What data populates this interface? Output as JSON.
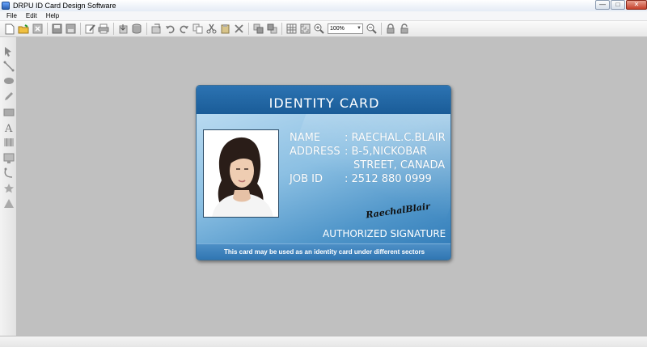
{
  "window": {
    "title": "DRPU ID Card Design Software",
    "minimize": "—",
    "maximize": "□",
    "close": "✕"
  },
  "menu": [
    {
      "label": "File"
    },
    {
      "label": "Edit"
    },
    {
      "label": "Help"
    }
  ],
  "toolbar": {
    "zoom": "100%",
    "zoom_arrow": "▼"
  },
  "card": {
    "title": "IDENTITY CARD",
    "name_label": "NAME",
    "name_value": ": RAECHAL.C.BLAIR",
    "address_label": "ADDRESS",
    "address_line1": ":  B-5,NICKOBAR",
    "address_line2": "STREET, CANADA",
    "jobid_label": "JOB ID",
    "jobid_value": ": 2512 880 0999",
    "signature": "RaechalBlair",
    "authorized": "AUTHORIZED SIGNATURE",
    "footer": "This card may be used as an identity card under different  sectors"
  },
  "colors": {
    "card_header": "#1a5c98",
    "canvas": "#c0c0c0"
  }
}
